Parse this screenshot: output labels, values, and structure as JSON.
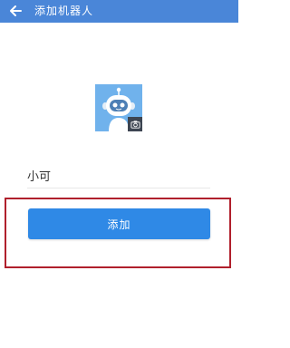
{
  "header": {
    "title": "添加机器人",
    "back_icon": "arrow-left-icon",
    "background": "#4a86d8"
  },
  "avatar": {
    "icon": "robot-icon",
    "badge_icon": "camera-icon",
    "background": "#70b2ec"
  },
  "form": {
    "name_value": "小可"
  },
  "actions": {
    "add_label": "添加",
    "button_color": "#2f89e6",
    "highlight_color": "#b0202c"
  }
}
